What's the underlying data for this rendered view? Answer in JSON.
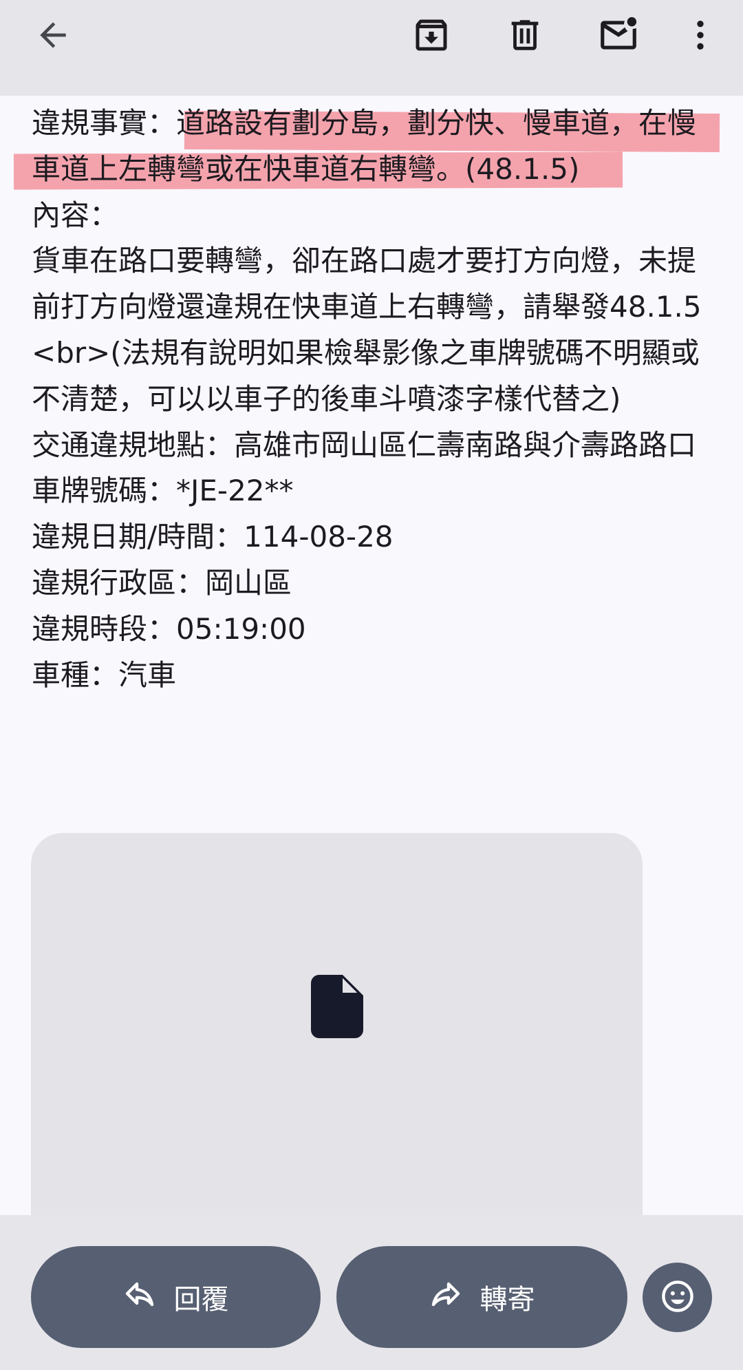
{
  "toolbar": {
    "back_icon": "arrow-back-icon",
    "archive_icon": "archive-icon",
    "delete_icon": "trash-icon",
    "mark_unread_icon": "mail-unread-icon",
    "more_icon": "more-vert-icon"
  },
  "body": {
    "lines": [
      "違規事實：道路設有劃分島，劃分快、慢車道，在慢車道上左轉彎或在快車道右轉彎。(48.1.5)",
      "內容：",
      "貨車在路口要轉彎，卻在路口處才要打方向燈，未提前打方向燈還違規在快車道上右轉彎，請舉發48.1.5<br>(法規有說明如果檢舉影像之車牌號碼不明顯或不清楚，可以以車子的後車斗噴漆字樣代替之)",
      "交通違規地點：高雄市岡山區仁壽南路與介壽路路口",
      "車牌號碼：*JE-22**",
      "違規日期/時間：114-08-28",
      "違規行政區：岡山區",
      "違規時段：05:19:00",
      "車種：汽車"
    ],
    "highlight_color": "#f05c6c"
  },
  "attachment": {
    "icon": "file-icon"
  },
  "actions": {
    "reply_label": "回覆",
    "forward_label": "轉寄",
    "reply_icon": "reply-icon",
    "forward_icon": "forward-icon",
    "emoji_icon": "emoji-icon"
  }
}
